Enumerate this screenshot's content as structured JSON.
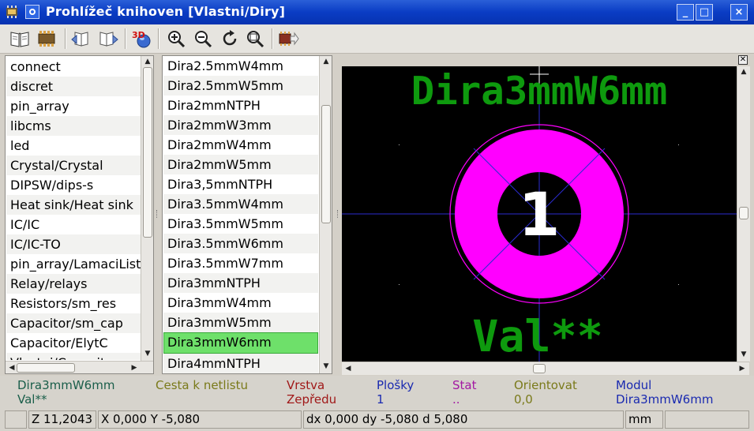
{
  "window": {
    "title": "Prohlížeč knihoven [Vlastni/Diry]",
    "controls": [
      "_",
      "□",
      "×"
    ]
  },
  "toolbar": {
    "tools": [
      "select-library-icon",
      "select-footprint-icon",
      "previous-footprint-icon",
      "next-footprint-icon",
      "3d-view-icon",
      "zoom-in-icon",
      "zoom-out-icon",
      "redraw-icon",
      "zoom-fit-icon",
      "export-to-editor-icon"
    ],
    "three_d_label": "3D"
  },
  "libraries": {
    "items": [
      "connect",
      "discret",
      "pin_array",
      "libcms",
      "led",
      "Crystal/Crystal",
      "DIPSW/dips-s",
      "Heat sink/Heat sink",
      "IC/IC",
      "IC/IC-TO",
      "pin_array/LamaciListy",
      "Relay/relays",
      "Resistors/sm_res",
      "Capacitor/sm_cap",
      "Capacitor/ElytC",
      "Vlastni/Capacitors"
    ]
  },
  "footprints": {
    "items": [
      "Dira2.5mmW4mm",
      "Dira2.5mmW5mm",
      "Dira2mmNTPH",
      "Dira2mmW3mm",
      "Dira2mmW4mm",
      "Dira2mmW5mm",
      "Dira3,5mmNTPH",
      "Dira3.5mmW4mm",
      "Dira3.5mmW5mm",
      "Dira3.5mmW6mm",
      "Dira3.5mmW7mm",
      "Dira3mmNTPH",
      "Dira3mmW4mm",
      "Dira3mmW5mm",
      "Dira3mmW6mm",
      "Dira4mmNTPH"
    ],
    "selected_index": 14
  },
  "canvas": {
    "reference": "Dira3mmW6mm",
    "value": "Val**",
    "pad_number": "1",
    "colors": {
      "background": "#000000",
      "text": "#0e9a0e",
      "pad": "#ff00ff",
      "axis": "#2b2bd0"
    }
  },
  "info": {
    "columns": [
      {
        "label": "Dira3mmW6mm",
        "value": "Val**",
        "label_color": "#1a5e4a",
        "value_color": "#1a5e4a"
      },
      {
        "label": "Cesta k netlistu",
        "value": "",
        "label_color": "#7a7a1a",
        "value_color": "#7a7a1a"
      },
      {
        "label": "Vrstva",
        "value": "Zepředu",
        "label_color": "#a01818",
        "value_color": "#a01818"
      },
      {
        "label": "Plošky",
        "value": "1",
        "label_color": "#1a2ab0",
        "value_color": "#1a2ab0"
      },
      {
        "label": "Stat",
        "value": "..",
        "label_color": "#a318a3",
        "value_color": "#a318a3"
      },
      {
        "label": "Orientovat",
        "value": "0,0",
        "label_color": "#7a7a1a",
        "value_color": "#7a7a1a"
      },
      {
        "label": "Modul",
        "value": "Dira3mmW6mm",
        "label_color": "#1a2ab0",
        "value_color": "#1a2ab0"
      }
    ]
  },
  "status": {
    "zoom": "Z 11,2043",
    "xy": "X 0,000  Y -5,080",
    "delta": "dx 0,000  dy -5,080  d 5,080",
    "units": "mm"
  }
}
